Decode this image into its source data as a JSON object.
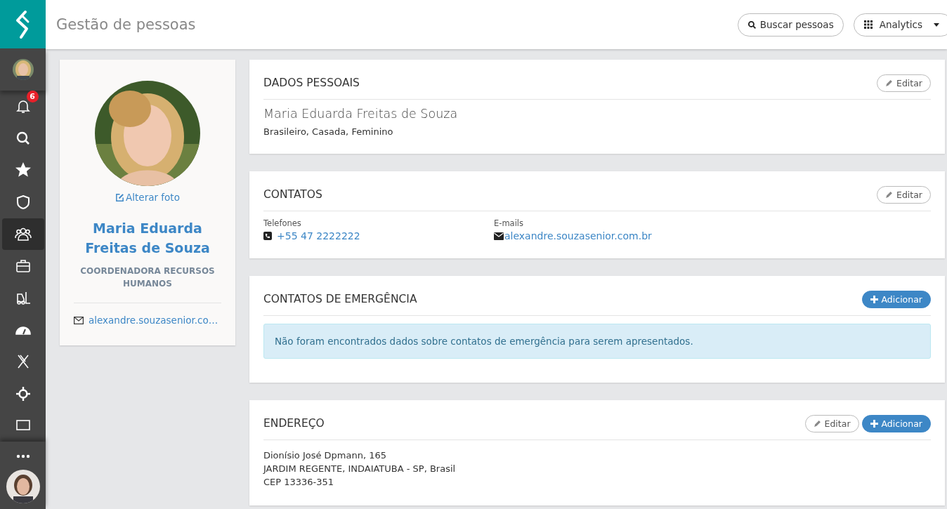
{
  "header": {
    "title": "Gestão de pessoas",
    "search_button": "Buscar pessoas",
    "app_menu": "Analytics"
  },
  "sidebar": {
    "items": [
      {
        "kind": "avatar",
        "selected": false
      },
      {
        "kind": "bell",
        "selected": false,
        "badge": "6"
      },
      {
        "kind": "search",
        "selected": false
      },
      {
        "kind": "star",
        "selected": false
      },
      {
        "kind": "shield",
        "selected": false
      },
      {
        "kind": "people",
        "selected": true
      },
      {
        "kind": "briefcase",
        "selected": false
      },
      {
        "kind": "forklift",
        "selected": false
      },
      {
        "kind": "gauge",
        "selected": false
      },
      {
        "kind": "x",
        "selected": false
      },
      {
        "kind": "crosshair",
        "selected": false
      },
      {
        "kind": "monitor",
        "selected": false
      }
    ]
  },
  "profile": {
    "change_photo": "Alterar foto",
    "name": "Maria Eduarda Freitas de Souza",
    "role": "COORDENADORA RECURSOS HUMANOS",
    "email": "alexandre.souzasenior.co…"
  },
  "sections": [
    {
      "kind": "personal",
      "title": "DADOS PESSOAIS",
      "actions": [
        {
          "kind": "edit",
          "label": "Editar"
        }
      ],
      "name": "Maria Eduarda Freitas de Souza",
      "details": "Brasileiro, Casada, Feminino"
    },
    {
      "kind": "contacts",
      "title": "CONTATOS",
      "actions": [
        {
          "kind": "edit",
          "label": "Editar"
        }
      ],
      "phones_label": "Telefones",
      "phone": "+55 47 2222222",
      "emails_label": "E-mails",
      "email": "alexandre.souzasenior.com.br"
    },
    {
      "kind": "emergency",
      "title": "CONTATOS DE EMERGÊNCIA",
      "actions": [
        {
          "kind": "add",
          "label": "Adicionar"
        }
      ],
      "alert": "Não foram encontrados dados sobre contatos de emergência para serem apresentados."
    },
    {
      "kind": "address",
      "title": "ENDEREÇO",
      "actions": [
        {
          "kind": "edit",
          "label": "Editar"
        },
        {
          "kind": "add",
          "label": "Adicionar"
        }
      ],
      "lines": [
        "Dionísio José Dpmann, 165",
        "JARDIM REGENTE, INDAIATUBA - SP, Brasil",
        "CEP 13336-351"
      ]
    }
  ]
}
